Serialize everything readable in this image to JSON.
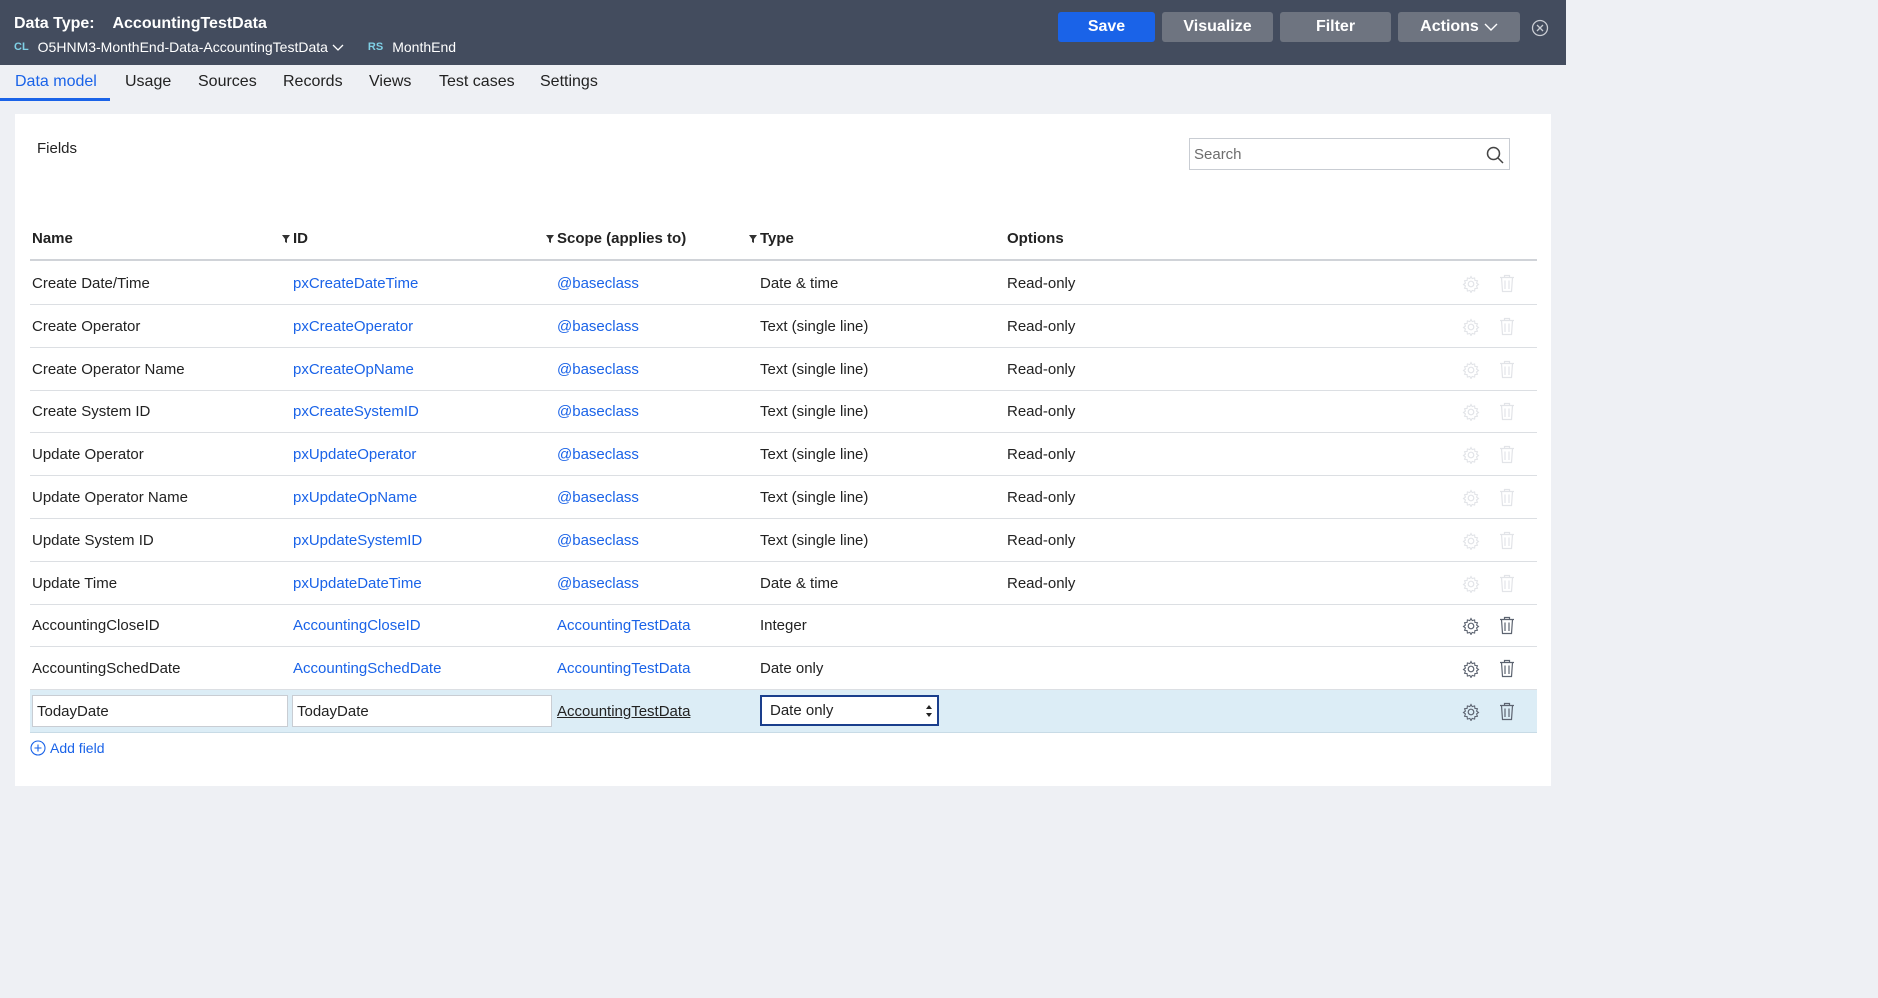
{
  "header": {
    "data_type_label": "Data Type:",
    "data_type_name": "AccountingTestData",
    "cl_tag": "CL",
    "class_name": "O5HNM3-MonthEnd-Data-AccountingTestData",
    "rs_tag": "RS",
    "ruleset": "MonthEnd",
    "buttons": {
      "save": "Save",
      "visualize": "Visualize",
      "filter": "Filter",
      "actions": "Actions"
    }
  },
  "tabs": [
    "Data model",
    "Usage",
    "Sources",
    "Records",
    "Views",
    "Test cases",
    "Settings"
  ],
  "active_tab": "Data model",
  "panel": {
    "title": "Fields",
    "search_placeholder": "Search"
  },
  "columns": {
    "name": "Name",
    "id": "ID",
    "scope": "Scope (applies to)",
    "type": "Type",
    "options": "Options"
  },
  "rows": [
    {
      "name": "Create Date/Time",
      "id": "pxCreateDateTime",
      "scope": "@baseclass",
      "type": "Date & time",
      "options": "Read-only"
    },
    {
      "name": "Create Operator",
      "id": "pxCreateOperator",
      "scope": "@baseclass",
      "type": "Text (single line)",
      "options": "Read-only"
    },
    {
      "name": "Create Operator Name",
      "id": "pxCreateOpName",
      "scope": "@baseclass",
      "type": "Text (single line)",
      "options": "Read-only"
    },
    {
      "name": "Create System ID",
      "id": "pxCreateSystemID",
      "scope": "@baseclass",
      "type": "Text (single line)",
      "options": "Read-only"
    },
    {
      "name": "Update Operator",
      "id": "pxUpdateOperator",
      "scope": "@baseclass",
      "type": "Text (single line)",
      "options": "Read-only"
    },
    {
      "name": "Update Operator Name",
      "id": "pxUpdateOpName",
      "scope": "@baseclass",
      "type": "Text (single line)",
      "options": "Read-only"
    },
    {
      "name": "Update System ID",
      "id": "pxUpdateSystemID",
      "scope": "@baseclass",
      "type": "Text (single line)",
      "options": "Read-only"
    },
    {
      "name": "Update Time",
      "id": "pxUpdateDateTime",
      "scope": "@baseclass",
      "type": "Date & time",
      "options": "Read-only"
    },
    {
      "name": "AccountingCloseID",
      "id": "AccountingCloseID",
      "scope": "AccountingTestData",
      "type": "Integer",
      "options": ""
    },
    {
      "name": "AccountingSchedDate",
      "id": "AccountingSchedDate",
      "scope": "AccountingTestData",
      "type": "Date only",
      "options": ""
    }
  ],
  "edit_row": {
    "name_value": "TodayDate",
    "id_value": "TodayDate",
    "scope": "AccountingTestData",
    "type_selected": "Date only"
  },
  "add_field_label": "Add field",
  "colors": {
    "header_bg": "#434c5e",
    "accent": "#1a63e8",
    "selected_row": "#dcedf6"
  }
}
